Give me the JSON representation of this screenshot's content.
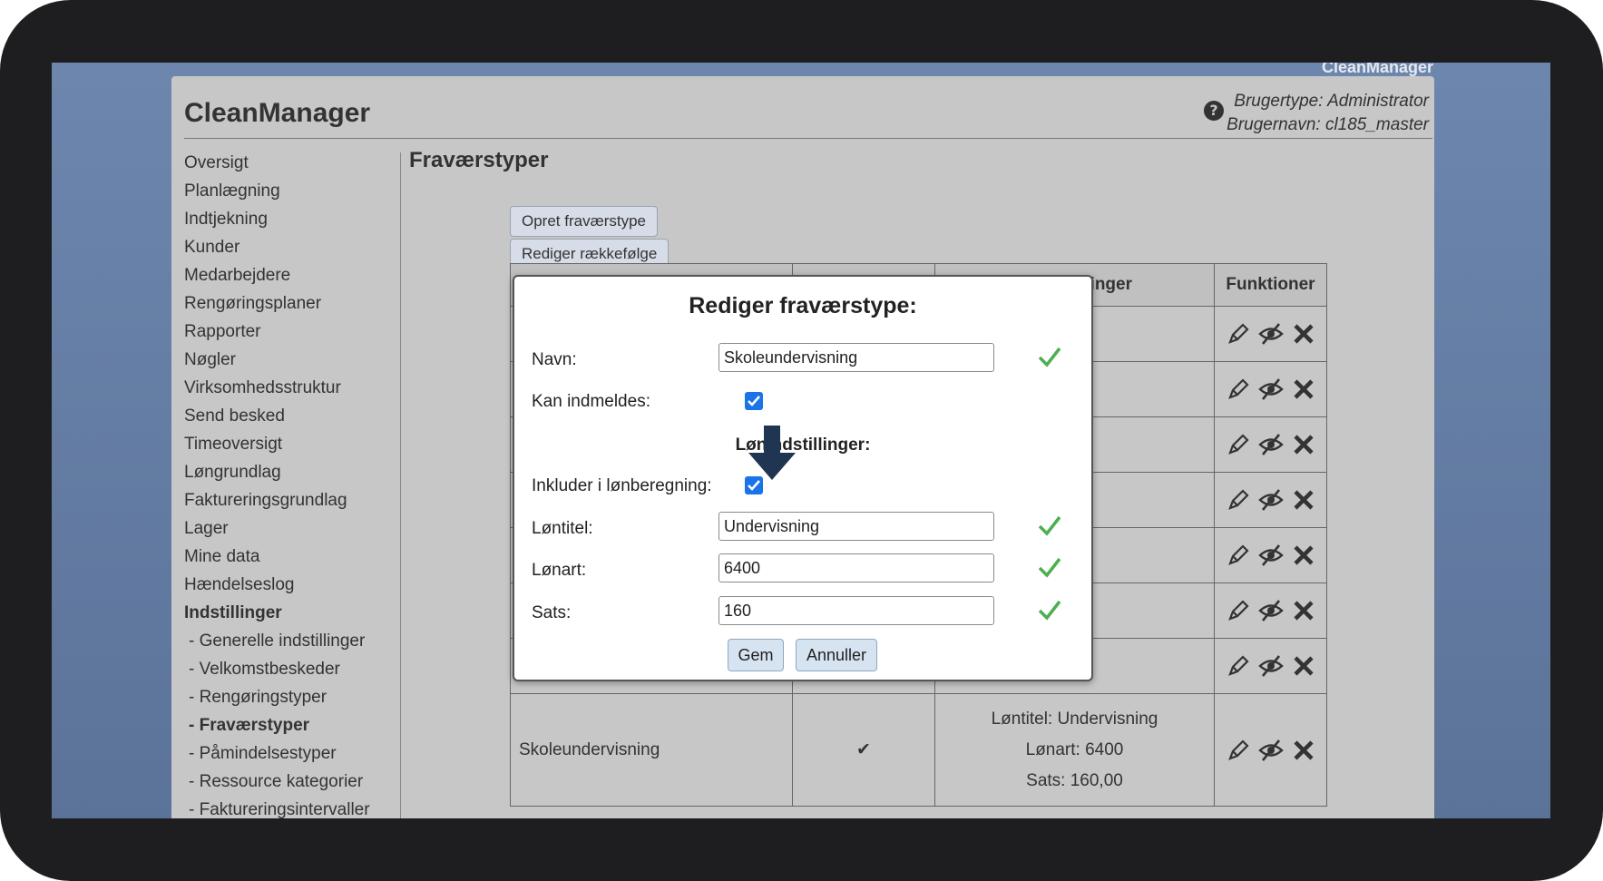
{
  "window": {
    "brand_top": "CleanManager"
  },
  "header": {
    "app_title": "CleanManager",
    "help_icon": "question-circle-icon",
    "user_type": "Brugertype: Administrator",
    "user_name": "Brugernavn: cl185_master"
  },
  "sidebar": {
    "items": [
      "Oversigt",
      "Planlægning",
      "Indtjekning",
      "Kunder",
      "Medarbejdere",
      "Rengøringsplaner",
      "Rapporter",
      "Nøgler",
      "Virksomhedsstruktur",
      "Send besked",
      "Timeoversigt",
      "Løngrundlag",
      "Faktureringsgrundlag",
      "Lager",
      "Mine data",
      "Hændelseslog"
    ],
    "section": "Indstillinger",
    "sub_items": [
      "- Generelle indstillinger",
      "- Velkomstbeskeder",
      "- Rengøringstyper",
      "- Fraværstyper",
      "- Påmindelsestyper",
      "- Ressource kategorier",
      "- Faktureringsintervaller"
    ],
    "active_sub": "- Fraværstyper"
  },
  "main": {
    "title": "Fraværstyper",
    "create_button": "Opret fraværstype",
    "reorder_button": "Rediger rækkefølge",
    "table": {
      "headers": {
        "col3_partial": "linger",
        "functions": "Funktioner"
      },
      "last_row": {
        "name": "Skoleundervisning",
        "check": "✔",
        "loentitel": "Løntitel: Undervisning",
        "loenart": "Lønart: 6400",
        "sats": "Sats: 160,00"
      }
    }
  },
  "modal": {
    "title": "Rediger fraværstype:",
    "name_label": "Navn:",
    "name_value": "Skoleundervisning",
    "can_report_label": "Kan indmeldes:",
    "salary_section": "Lønindstillinger:",
    "include_label": "Inkluder i lønberegning:",
    "loentitel_label": "Løntitel:",
    "loentitel_value": "Undervisning",
    "loenart_label": "Lønart:",
    "loenart_value": "6400",
    "sats_label": "Sats:",
    "sats_value": "160",
    "save_button": "Gem",
    "cancel_button": "Annuller"
  },
  "colors": {
    "accent_check": "#4caf50",
    "checkbox": "#1a73e8",
    "arrow": "#1f3552"
  }
}
